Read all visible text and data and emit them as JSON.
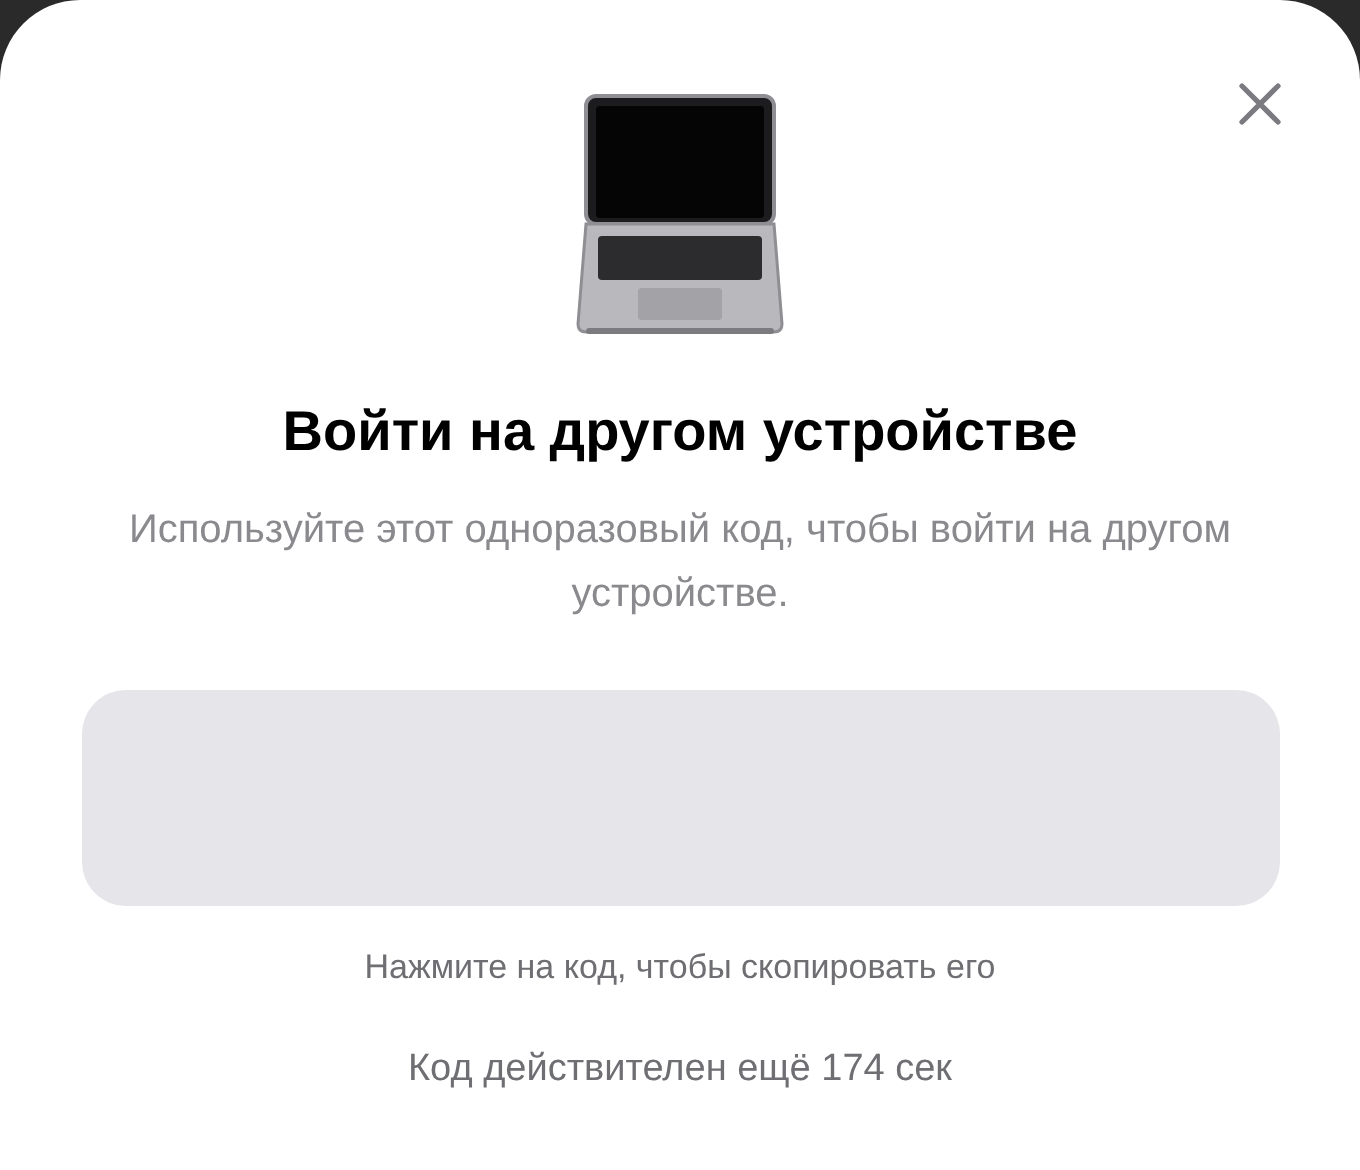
{
  "dialog": {
    "title": "Войти на другом устройстве",
    "description": "Используйте этот одноразовый код, чтобы войти на другом устройстве.",
    "copy_hint": "Нажмите на код, чтобы скопировать его",
    "expiry": "Код действителен ещё 174 сек"
  }
}
